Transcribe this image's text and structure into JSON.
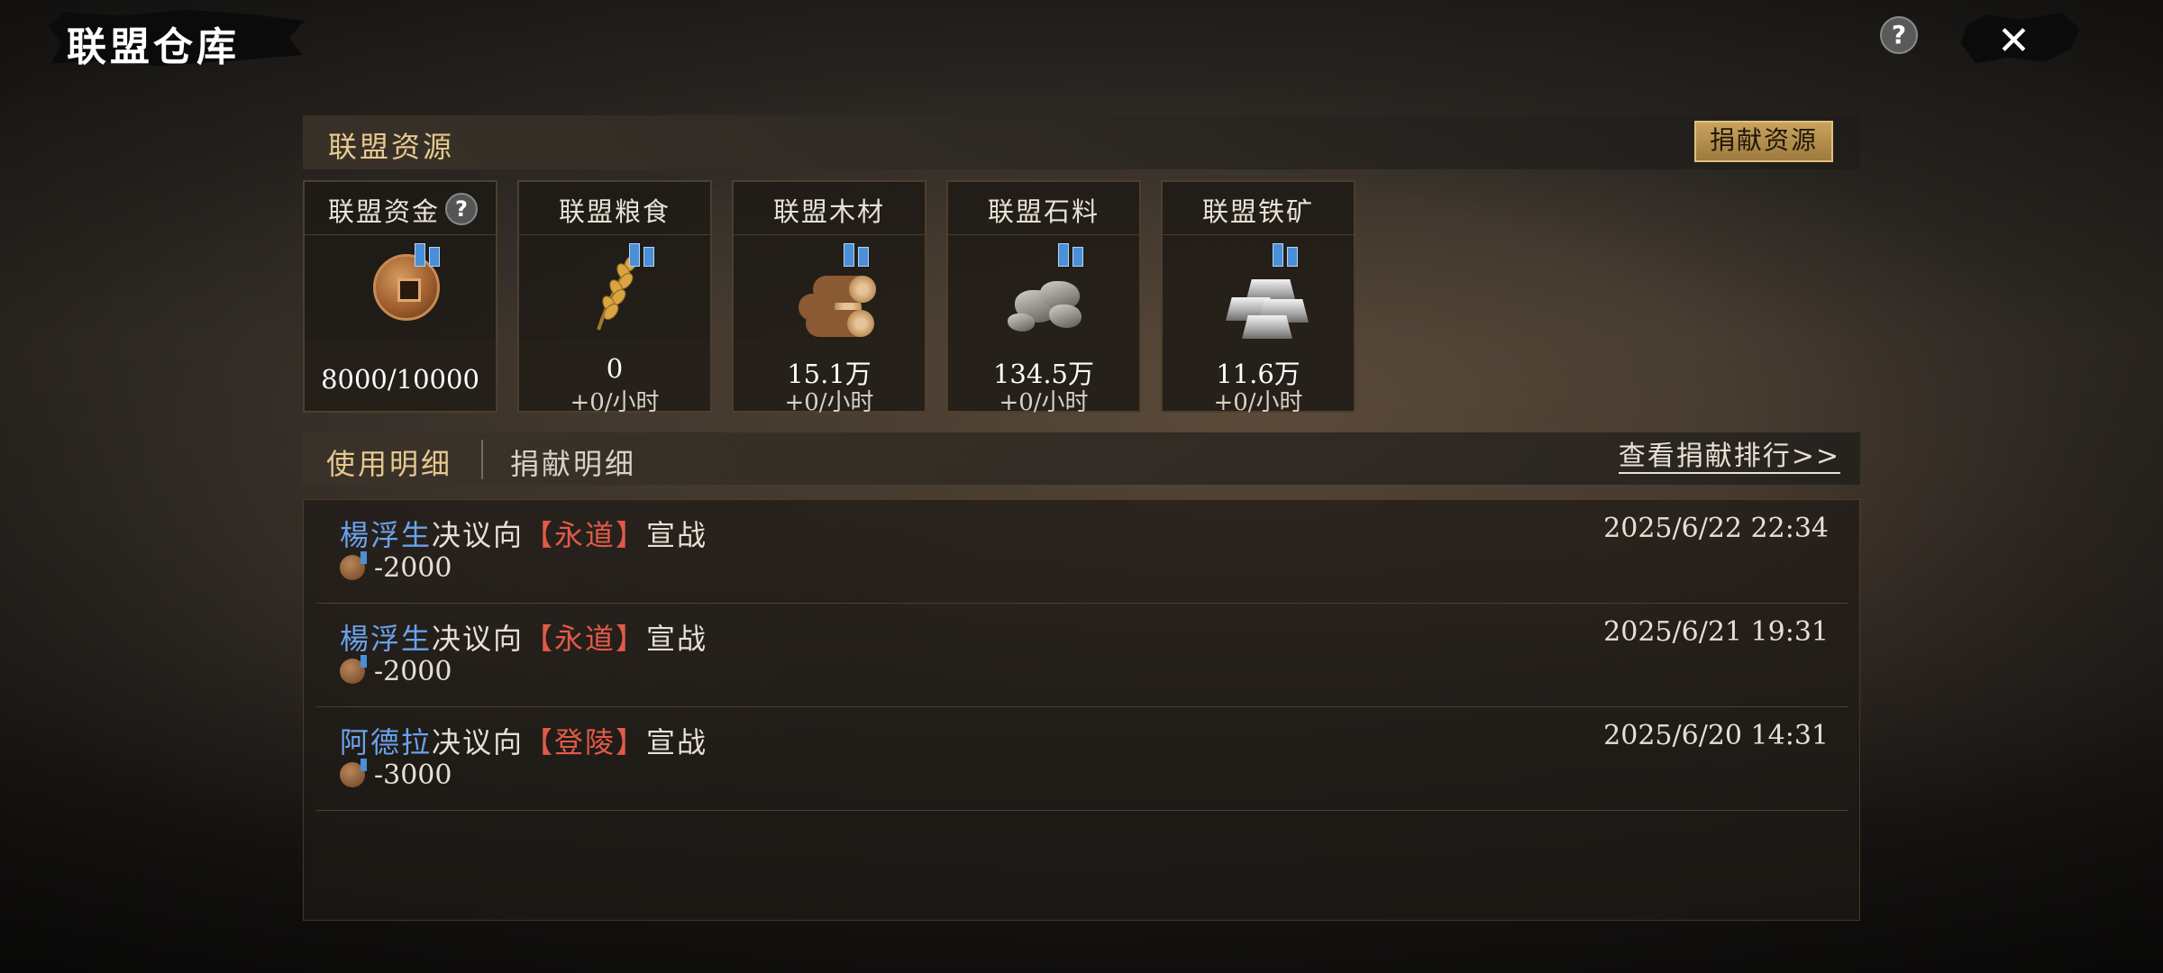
{
  "window": {
    "title": "联盟仓库",
    "help_icon": "?",
    "close_icon": "✕"
  },
  "resources": {
    "section_title": "联盟资源",
    "donate_button": "捐献资源",
    "items": [
      {
        "label": "联盟资金",
        "icon": "coin-icon",
        "value": "8000/10000",
        "rate": "",
        "has_help": true
      },
      {
        "label": "联盟粮食",
        "icon": "grain-icon",
        "value": "0",
        "rate": "+0/小时",
        "has_help": false
      },
      {
        "label": "联盟木材",
        "icon": "wood-icon",
        "value": "15.1万",
        "rate": "+0/小时",
        "has_help": false
      },
      {
        "label": "联盟石料",
        "icon": "stone-icon",
        "value": "134.5万",
        "rate": "+0/小时",
        "has_help": false
      },
      {
        "label": "联盟铁矿",
        "icon": "iron-icon",
        "value": "11.6万",
        "rate": "+0/小时",
        "has_help": false
      }
    ],
    "help_mark": "?"
  },
  "tabs": {
    "usage": "使用明细",
    "donation": "捐献明细",
    "ranking_link": "查看捐献排行>>"
  },
  "log": [
    {
      "name": "楊浮生",
      "action": "决议向",
      "target": "【永道】",
      "suffix": "宣战",
      "amount": "-2000",
      "time": "2025/6/22 22:34"
    },
    {
      "name": "楊浮生",
      "action": "决议向",
      "target": "【永道】",
      "suffix": "宣战",
      "amount": "-2000",
      "time": "2025/6/21 19:31"
    },
    {
      "name": "阿德拉",
      "action": "决议向",
      "target": "【登陵】",
      "suffix": "宣战",
      "amount": "-3000",
      "time": "2025/6/20 14:31"
    }
  ],
  "colors": {
    "accent_gold": "#e6c98e",
    "name_blue": "#6aa2ec",
    "target_red": "#e25a48",
    "donate_button": "#c9a45e"
  }
}
